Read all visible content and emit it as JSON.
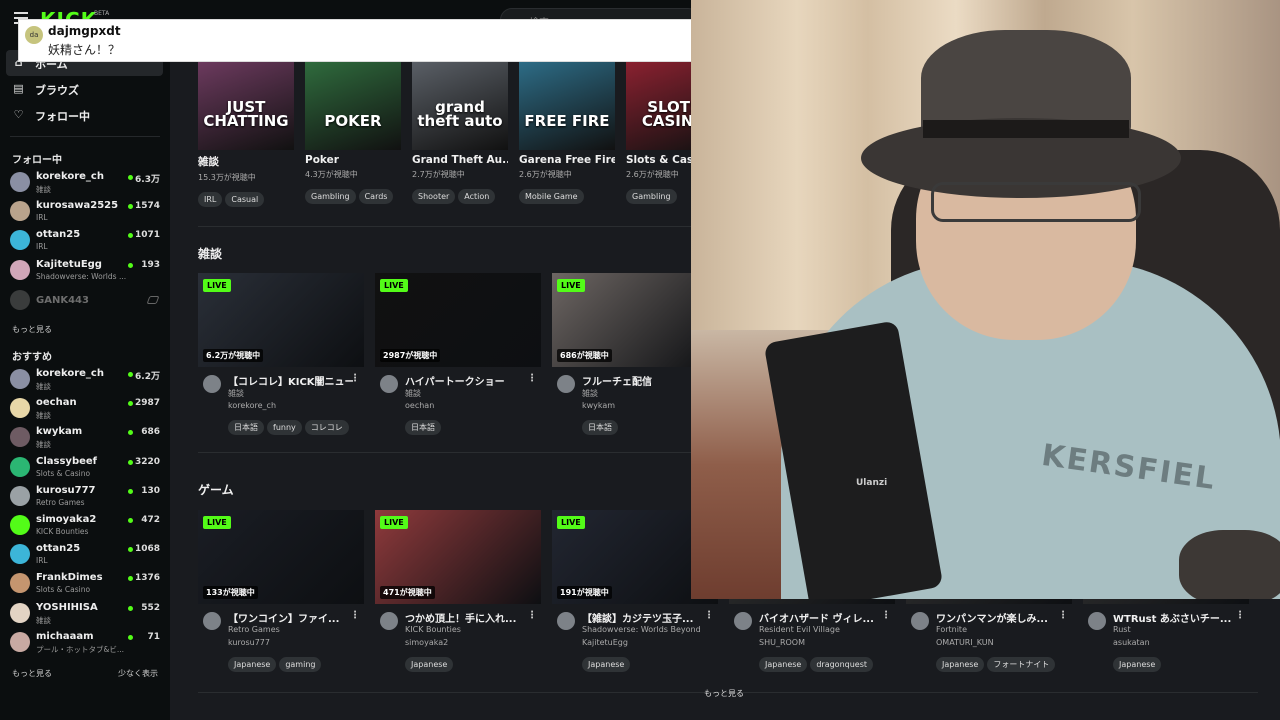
{
  "header": {
    "logo": "KICK",
    "logo_badge": "BETA",
    "search_placeholder": "検索"
  },
  "sidebar": {
    "nav": [
      {
        "label": "ホーム",
        "icon": "home-icon"
      },
      {
        "label": "ブラウズ",
        "icon": "browse-icon"
      },
      {
        "label": "フォロー中",
        "icon": "heart-icon"
      }
    ],
    "following_title": "フォロー中",
    "following": [
      {
        "name": "korekore_ch",
        "category": "雑談",
        "viewers": "6.3万",
        "color": "#8a8fa3"
      },
      {
        "name": "kurosawa2525",
        "category": "IRL",
        "viewers": "1574",
        "color": "#b9a38c"
      },
      {
        "name": "ottan25",
        "category": "IRL",
        "viewers": "1071",
        "color": "#3cb5d8"
      },
      {
        "name": "KajitetuEgg",
        "category": "Shadowverse: Worlds ...",
        "viewers": "193",
        "color": "#d1a6b8"
      }
    ],
    "offline_channel": "GANK443",
    "following_more": "もっと見る",
    "recommended_title": "おすすめ",
    "recommended": [
      {
        "name": "korekore_ch",
        "category": "雑談",
        "viewers": "6.2万",
        "color": "#8a8fa3"
      },
      {
        "name": "oechan",
        "category": "雑談",
        "viewers": "2987",
        "color": "#e8d7a8"
      },
      {
        "name": "kwykam",
        "category": "雑談",
        "viewers": "686",
        "color": "#6e5b63"
      },
      {
        "name": "Classybeef",
        "category": "Slots & Casino",
        "viewers": "3220",
        "color": "#2bb673"
      },
      {
        "name": "kurosu777",
        "category": "Retro Games",
        "viewers": "130",
        "color": "#9aa1a5"
      },
      {
        "name": "simoyaka2",
        "category": "KICK Bounties",
        "viewers": "472",
        "color": "#53fc18"
      },
      {
        "name": "ottan25",
        "category": "IRL",
        "viewers": "1068",
        "color": "#3cb5d8"
      },
      {
        "name": "FrankDimes",
        "category": "Slots & Casino",
        "viewers": "1376",
        "color": "#c4956f"
      },
      {
        "name": "YOSHIHISA",
        "category": "雑談",
        "viewers": "552",
        "color": "#e3d4c4"
      },
      {
        "name": "michaaam",
        "category": "プール・ホットタブ&ビ...",
        "viewers": "71",
        "color": "#c8a9a2"
      }
    ],
    "recommended_more": "もっと見る",
    "recommended_less": "少なく表示"
  },
  "categories": [
    {
      "name": "雑談",
      "viewers": "15.3万が視聴中",
      "tags": [
        "IRL",
        "Casual"
      ],
      "art": "JUST CHATTING",
      "color": "#6c3a5e"
    },
    {
      "name": "Poker",
      "viewers": "4.3万が視聴中",
      "tags": [
        "Gambling",
        "Cards"
      ],
      "art": "POKER",
      "color": "#2f6b3d"
    },
    {
      "name": "Grand Theft Au...",
      "viewers": "2.7万が視聴中",
      "tags": [
        "Shooter",
        "Action"
      ],
      "art": "grand theft auto",
      "color": "#5a5f66"
    },
    {
      "name": "Garena Free Fire",
      "viewers": "2.6万が視聴中",
      "tags": [
        "Mobile Game"
      ],
      "art": "FREE FIRE",
      "color": "#2d6c86"
    },
    {
      "name": "Slots & Casino",
      "viewers": "2.6万が視聴中",
      "tags": [
        "Gambling"
      ],
      "art": "SLOTS CASINO",
      "color": "#8a2130"
    }
  ],
  "section_chat": {
    "title": "雑談",
    "streams": [
      {
        "title": "【コレコレ】KICK闇ニュー...",
        "category": "雑談",
        "user": "korekore_ch",
        "viewers": "6.2万が視聴中",
        "tags": [
          "日本語",
          "funny",
          "コレコレ"
        ],
        "live": "LIVE",
        "color": "#2a2f38"
      },
      {
        "title": "ハイパートークショー",
        "category": "雑談",
        "user": "oechan",
        "viewers": "2987が視聴中",
        "tags": [
          "日本語"
        ],
        "live": "LIVE",
        "color": "#111111"
      },
      {
        "title": "フルーチェ配信",
        "category": "雑談",
        "user": "kwykam",
        "viewers": "686が視聴中",
        "tags": [
          "日本語"
        ],
        "live": "LIVE",
        "color": "#6d6663"
      }
    ]
  },
  "section_game": {
    "title": "ゲーム",
    "streams": [
      {
        "title": "【ワンコイン】ファイ...",
        "category": "Retro Games",
        "user": "kurosu777",
        "viewers": "133が視聴中",
        "tags": [
          "Japanese",
          "gaming"
        ],
        "live": "LIVE",
        "color": "#1a1d24"
      },
      {
        "title": "つかめ頂上！手に入れ...",
        "category": "KICK Bounties",
        "user": "simoyaka2",
        "viewers": "471が視聴中",
        "tags": [
          "Japanese"
        ],
        "live": "LIVE",
        "color": "#8f3a3c"
      },
      {
        "title": "【雑談】カジテツ玉子...",
        "category": "Shadowverse: Worlds Beyond",
        "user": "KajitetuEgg",
        "viewers": "191が視聴中",
        "tags": [
          "Japanese"
        ],
        "live": "LIVE",
        "color": "#222631"
      },
      {
        "title": "バイオハザード ヴィレ...",
        "category": "Resident Evil Village",
        "user": "SHU_ROOM",
        "viewers": "",
        "tags": [
          "Japanese",
          "dragonquest"
        ],
        "live": "",
        "color": "#333"
      },
      {
        "title": "ワンパンマンが楽しみ...",
        "category": "Fortnite",
        "user": "OMATURI_KUN",
        "viewers": "",
        "tags": [
          "Japanese",
          "フォートナイト"
        ],
        "live": "",
        "color": "#333"
      },
      {
        "title": "WTRust あぶさいチー...",
        "category": "Rust",
        "user": "asukatan",
        "viewers": "",
        "tags": [
          "Japanese"
        ],
        "live": "",
        "color": "#333"
      }
    ]
  },
  "more_label": "もっと見る",
  "chat_toast": {
    "avatar": "da",
    "user": "dajmgpxdt",
    "message": "妖精さん！？"
  },
  "webcam": {
    "device_label": "Ulanzi",
    "shirt_text": "KERSFIEL"
  },
  "colors": {
    "accent": "#53fc18",
    "background": "#191b1f",
    "sidebar": "#0b0e0f"
  }
}
